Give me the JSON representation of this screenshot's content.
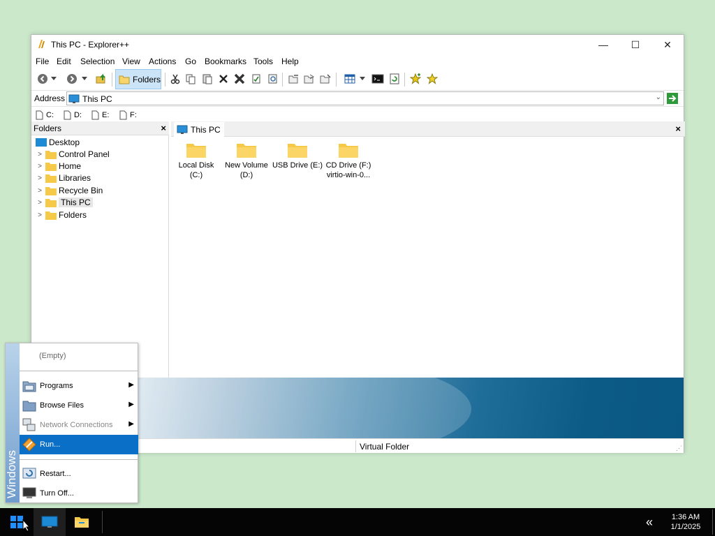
{
  "window": {
    "title": "This PC - Explorer++",
    "controls": {
      "minimize": "—",
      "maximize": "☐",
      "close": "✕"
    }
  },
  "menubar": [
    "File",
    "Edit",
    "Selection",
    "View",
    "Actions",
    "Go",
    "Bookmarks",
    "Tools",
    "Help"
  ],
  "toolbar": {
    "folders_label": "Folders",
    "icons": [
      "back-icon",
      "back-dropdown-icon",
      "forward-icon",
      "forward-dropdown-icon",
      "up-icon",
      "folders-icon",
      "cut-icon",
      "copy-icon",
      "paste-icon",
      "delete-icon",
      "delete-permanently-icon",
      "properties-icon",
      "search-icon",
      "copy-to-icon",
      "move-to-icon",
      "new-folder-icon",
      "views-icon",
      "views-dropdown-icon",
      "command-prompt-icon",
      "refresh-icon",
      "add-bookmark-icon",
      "bookmarks-icon"
    ]
  },
  "address": {
    "label": "Address",
    "value": "This PC"
  },
  "drives": [
    "C:",
    "D:",
    "E:",
    "F:"
  ],
  "folders_pane": {
    "header": "Folders",
    "close": "×",
    "tree": [
      {
        "label": "Desktop",
        "expander": ""
      },
      {
        "label": "Control Panel",
        "expander": ">"
      },
      {
        "label": "Home",
        "expander": ">"
      },
      {
        "label": "Libraries",
        "expander": ">"
      },
      {
        "label": "Recycle Bin",
        "expander": ">"
      },
      {
        "label": "This PC",
        "expander": ">",
        "selected": true
      },
      {
        "label": "Folders",
        "expander": ">"
      }
    ]
  },
  "tabs": {
    "active": "This PC",
    "close": "×"
  },
  "files": [
    {
      "line1": "Local Disk",
      "line2": "(C:)"
    },
    {
      "line1": "New Volume",
      "line2": "(D:)"
    },
    {
      "line1": "USB Drive (E:)",
      "line2": ""
    },
    {
      "line1": "CD Drive (F:)",
      "line2": "virtio-win-0..."
    }
  ],
  "statusbar": {
    "text": "Virtual Folder"
  },
  "start_menu": {
    "brand": "Windows",
    "empty": "(Empty)",
    "items": [
      {
        "label": "Programs",
        "submenu": true
      },
      {
        "label": "Browse Files",
        "submenu": true
      },
      {
        "label": "Network Connections",
        "submenu": true,
        "disabled": true
      },
      {
        "label": "Run...",
        "highlighted": true
      },
      {
        "label": "Restart..."
      },
      {
        "label": "Turn Off..."
      }
    ]
  },
  "taskbar": {
    "tray_chevron": "«",
    "time": "1:36 AM",
    "date": "1/1/2025"
  },
  "colors": {
    "desktop": "#cbe8cb",
    "accent": "#0a6fc7",
    "folder": "#f7c948",
    "taskbar": "#050505"
  }
}
